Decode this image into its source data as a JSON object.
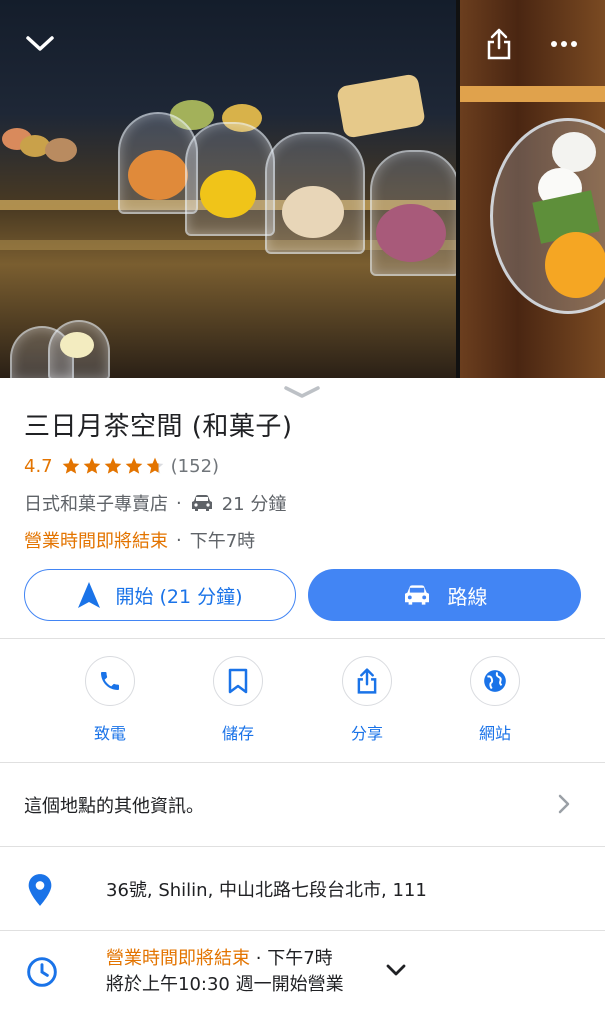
{
  "place": {
    "name": "三日月茶空間 (和菓子)",
    "rating": "4.7",
    "review_count": "(152)",
    "category": "日式和菓子專賣店",
    "drive_time": "21 分鐘",
    "hours_status": "營業時間即將結束",
    "closing_time": "下午7時",
    "separator": "·"
  },
  "buttons": {
    "start_label": "開始 (21 分鐘)",
    "route_label": "路線"
  },
  "actions": [
    {
      "label": "致電",
      "icon": "phone-icon"
    },
    {
      "label": "儲存",
      "icon": "bookmark-icon"
    },
    {
      "label": "分享",
      "icon": "share-icon"
    },
    {
      "label": "網站",
      "icon": "globe-icon"
    }
  ],
  "more_info": {
    "label": "這個地點的其他資訊。"
  },
  "address": "36號, Shilin, 中山北路七段台北市, 111",
  "hours_detail": {
    "status": "營業時間即將結束",
    "closing": "下午7時",
    "next_open": "將於上午10:30 週一開始營業"
  },
  "colors": {
    "accent": "#4285f4",
    "link": "#1a73e8",
    "warning": "#e37400",
    "star": "#e37400"
  }
}
